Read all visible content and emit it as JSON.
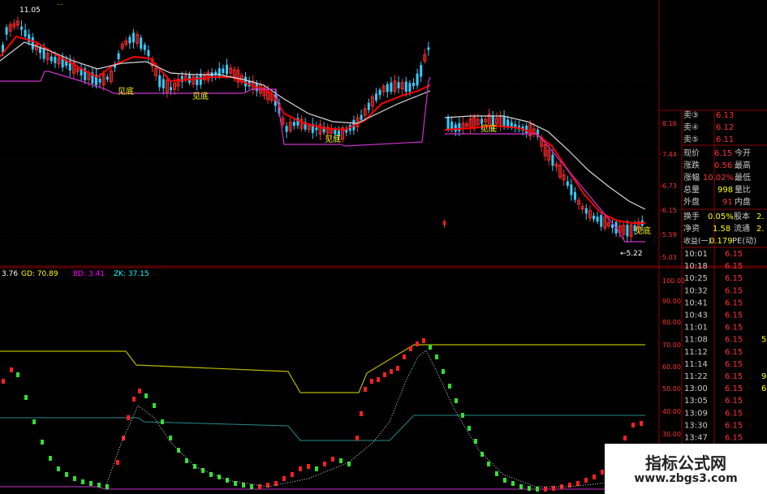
{
  "header": {
    "title": "...",
    "high_marker": "11.05",
    "low_marker": "←5.22"
  },
  "signals": [
    "见底",
    "见底",
    "见底",
    "见底",
    "见底"
  ],
  "price_axis": [
    "8.16",
    "7.44",
    "6.73",
    "6.15",
    "5.59",
    "5.03"
  ],
  "quote_panel": {
    "sell_rows": [
      {
        "label": "卖③",
        "value": "6.13"
      },
      {
        "label": "卖④",
        "value": "6.12"
      },
      {
        "label": "卖⑤",
        "value": "6.11"
      }
    ],
    "rows": [
      {
        "l1": "现价",
        "v1": "6.15",
        "l2": "今开",
        "v2": ""
      },
      {
        "l1": "涨跌",
        "v1": "0.56",
        "l2": "最高",
        "v2": ""
      },
      {
        "l1": "涨幅",
        "v1": "10.02%",
        "l2": "最低",
        "v2": ""
      },
      {
        "l1": "总量",
        "v1": "998",
        "l2": "量比",
        "v2": ""
      },
      {
        "l1": "外盘",
        "v1": "91",
        "l2": "内盘",
        "v2": ""
      }
    ],
    "rows2": [
      {
        "l1": "换手",
        "v1": "0.05%",
        "l2": "股本",
        "v2": "2."
      },
      {
        "l1": "净资",
        "v1": "1.58",
        "l2": "流通",
        "v2": "2."
      },
      {
        "l1": "收益(一)",
        "v1": "0.179",
        "l2": "PE(动)",
        "v2": ""
      }
    ]
  },
  "indicator": {
    "readout": [
      {
        "label": "3.76",
        "color": "#ffffff"
      },
      {
        "label": "GD: 70.89",
        "color": "#ffff00"
      },
      {
        "label": "BD: 3.41",
        "color": "#ff00ff"
      },
      {
        "label": "ZK: 37.15",
        "color": "#00ffff"
      }
    ],
    "axis": [
      "100.00",
      "90.00",
      "80.00",
      "70.00",
      "60.00",
      "50.00",
      "40.00",
      "30.00"
    ]
  },
  "ticks": [
    {
      "time": "10:01",
      "price": "6.15"
    },
    {
      "time": "10:18",
      "price": "6.15"
    },
    {
      "time": "10:25",
      "price": "6.15"
    },
    {
      "time": "10:32",
      "price": "6.15"
    },
    {
      "time": "10:41",
      "price": "6.15"
    },
    {
      "time": "10:43",
      "price": "6.15"
    },
    {
      "time": "11:01",
      "price": "6.15"
    },
    {
      "time": "11:08",
      "price": "6.15"
    },
    {
      "time": "11:12",
      "price": "6.15"
    },
    {
      "time": "11:14",
      "price": "6.15"
    },
    {
      "time": "11:22",
      "price": "6.15"
    },
    {
      "time": "13:00",
      "price": "6.15"
    },
    {
      "time": "13:05",
      "price": "6.15"
    },
    {
      "time": "13:09",
      "price": "6.15"
    },
    {
      "time": "13:30",
      "price": "6.15"
    },
    {
      "time": "13:47",
      "price": "6.15"
    },
    {
      "time": "14:16",
      "price": "6.15"
    }
  ],
  "ticks_right": [
    "",
    "",
    "",
    "",
    "",
    "",
    "",
    "5",
    "",
    "",
    "9",
    "6",
    "",
    "",
    "",
    "",
    ""
  ],
  "watermark": {
    "line1": "指标公式网",
    "line2": "www.zbgs3.com"
  },
  "colors": {
    "up": "#ff2a2a",
    "down": "#33ccff",
    "ma_red": "#ff0000",
    "ma_white": "#d8d8d8",
    "support": "#cc33cc",
    "gd": "#b8b800",
    "zk": "#2a8a8a",
    "osc_up": "#ff2020",
    "osc_down": "#33dd33",
    "grid": "#8b0000"
  }
}
